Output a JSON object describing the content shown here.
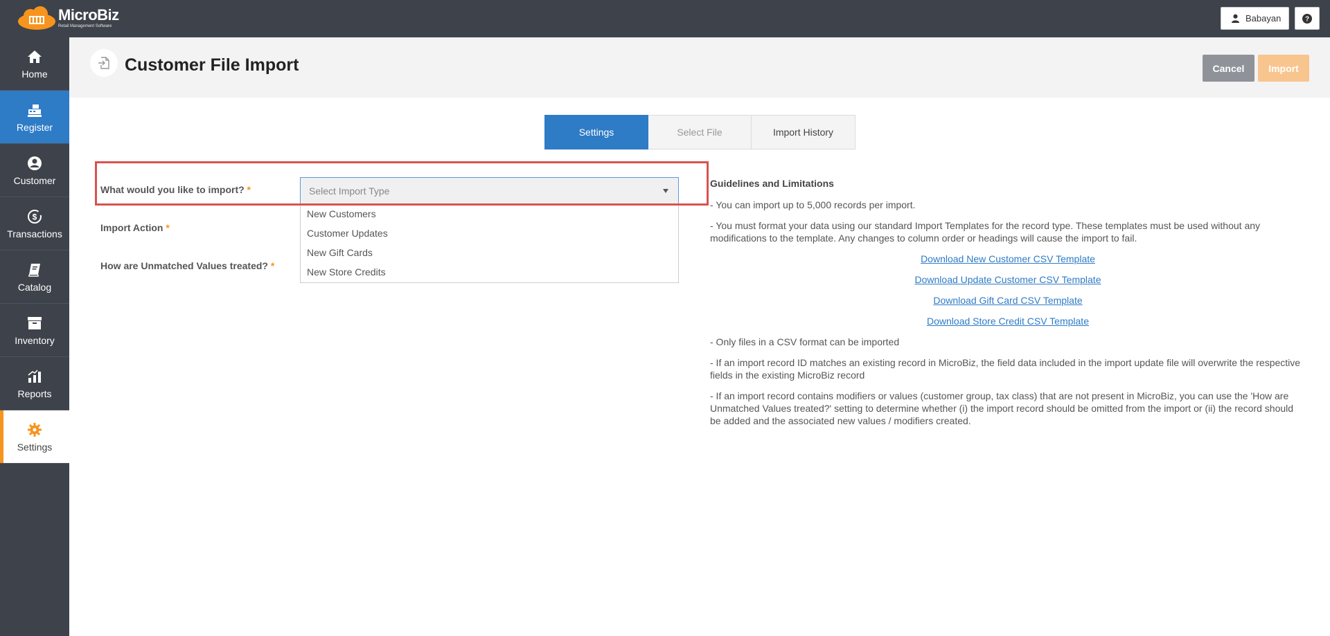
{
  "app": {
    "logo_name": "MicroBiz",
    "logo_tagline": "Retail Management Software",
    "user_name": "Babayan",
    "help_label": "?"
  },
  "sidebar": {
    "items": [
      {
        "label": "Home",
        "icon": "home-icon"
      },
      {
        "label": "Register",
        "icon": "register-icon"
      },
      {
        "label": "Customer",
        "icon": "customer-icon"
      },
      {
        "label": "Transactions",
        "icon": "transactions-icon"
      },
      {
        "label": "Catalog",
        "icon": "catalog-icon"
      },
      {
        "label": "Inventory",
        "icon": "inventory-icon"
      },
      {
        "label": "Reports",
        "icon": "reports-icon"
      },
      {
        "label": "Settings",
        "icon": "settings-icon"
      }
    ]
  },
  "header": {
    "title": "Customer File Import",
    "cancel_label": "Cancel",
    "import_label": "Import"
  },
  "tabs": [
    {
      "label": "Settings",
      "state": "active"
    },
    {
      "label": "Select File",
      "state": "disabled"
    },
    {
      "label": "Import History",
      "state": "default"
    }
  ],
  "form": {
    "import_question": "What would you like to import?",
    "import_action": "Import Action",
    "unmatched": "How are Unmatched Values treated?",
    "required_marker": "*",
    "select_placeholder": "Select Import Type",
    "options": [
      "New Customers",
      "Customer Updates",
      "New Gift Cards",
      "New Store Credits"
    ]
  },
  "guidelines": {
    "title": "Guidelines and Limitations",
    "p1": "- You can import up to 5,000 records per import.",
    "p2": "- You must format your data using our standard Import Templates for the record type. These templates must be used without any modifications to the template. Any changes to column order or headings will cause the import to fail.",
    "links": [
      "Download New Customer CSV Template",
      "Download Update Customer CSV Template",
      "Download Gift Card CSV Template",
      "Download Store Credit CSV Template"
    ],
    "p3": "- Only files in a CSV format can be imported",
    "p4": "- If an import record ID matches an existing record in MicroBiz, the field data included in the import update file will overwrite the respective fields in the existing MicroBiz record",
    "p5": "- If an import record contains modifiers or values (customer group, tax class) that are not present in MicroBiz, you can use the 'How are Unmatched Values treated?' setting to determine whether (i) the import record should be omitted from the import or (ii) the record should be added and the associated new values / modifiers created."
  },
  "colors": {
    "topbar": "#3e434b",
    "accent_blue": "#2e7bc6",
    "accent_orange": "#f7941d",
    "highlight_red": "#d9534f"
  }
}
